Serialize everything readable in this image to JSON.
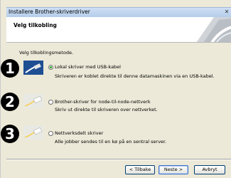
{
  "window": {
    "title": "Installere Brother-skriverdriver",
    "close_glyph": "✕"
  },
  "header": {
    "title": "Velg tilkobling"
  },
  "content": {
    "instruction": "Velg tilkoblingsmetode.",
    "options": [
      {
        "marker": "1",
        "label": "Lokal skriver med USB-kabel",
        "description": "Skriveren er koblet direkte til denne datamaskinen via en USB-kabel.",
        "selected": true,
        "icon": "usb-cable-icon"
      },
      {
        "marker": "2",
        "label": "Brother-skriver for node-til-node-nettverk",
        "description": "Skriv ut direkte til skriveren over nettverket.",
        "selected": false,
        "icon": "network-cable-icon"
      },
      {
        "marker": "3",
        "label": "Nettverksdelt skriver",
        "description": "Alle jobber sendes til en kø på en sentral server.",
        "selected": false,
        "icon": "network-cable-icon"
      }
    ]
  },
  "buttons": {
    "back": "< Tilbake",
    "next": "Neste >",
    "cancel": "Avbryt"
  },
  "colors": {
    "thumb_bg": "#1f4f93",
    "radio_selected": "#1c9a1c"
  }
}
